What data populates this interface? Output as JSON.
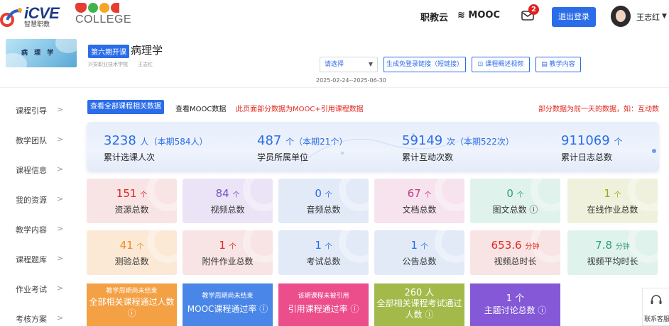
{
  "header": {
    "icve_logo": "iCVE",
    "icve_sub": "智慧职教",
    "mooc_logo": "MOOC",
    "college_logo": "COLLEGE",
    "nav_zhijiaoyun": "职教云",
    "nav_mooc": "MOOC",
    "message_count": "2",
    "logout_label": "退出登录",
    "user_name": "王志红",
    "colors": {
      "mooc_m": "#e63d32",
      "mooc_o1": "#3fb549",
      "mooc_o2": "#f5a623",
      "mooc_c": "#e63d32",
      "primary": "#2b6de8"
    }
  },
  "course": {
    "cover_title": "病 理 学",
    "term_tag": "第六期开课",
    "title": "病理学",
    "school": "兴安职业技术学院",
    "teacher": "王志红",
    "select_value": "请选择",
    "btn_share_link": "生成免登录链接（短链接）",
    "btn_overview_video": "课程概述视频",
    "btn_teaching_content": "教学内容",
    "date_range": "2025-02-24--2025-06-30"
  },
  "sidebar": {
    "items": [
      {
        "label": "课程引导"
      },
      {
        "label": "教学团队"
      },
      {
        "label": "课程信息"
      },
      {
        "label": "我的资源"
      },
      {
        "label": "教学内容"
      },
      {
        "label": "课程题库"
      },
      {
        "label": "作业考试"
      },
      {
        "label": "考核方案"
      }
    ]
  },
  "filters": {
    "tab_all": "查看全部课程相关数据",
    "tab_mooc": "查看MOOC数据",
    "note_left": "此页面部分数据为MOOC+引用课程数据",
    "note_right": "部分数据为前一天的数据，如：互动数"
  },
  "summary": [
    {
      "value": "3238",
      "unit": "人",
      "extra": "（本期584人）",
      "label": "累计选课人次"
    },
    {
      "value": "487",
      "unit": "个",
      "extra": "（本期21个）",
      "label": "学员所属单位"
    },
    {
      "value": "59149",
      "unit": "次",
      "extra": "（本期522次）",
      "label": "累计互动次数"
    },
    {
      "value": "911069",
      "unit": "个",
      "extra": "",
      "label": "累计日志总数"
    }
  ],
  "cards_row1": [
    {
      "value": "151",
      "unit": "个",
      "label": "资源总数",
      "color": "#e0271c"
    },
    {
      "value": "84",
      "unit": "个",
      "label": "视频总数",
      "color": "#7b52c9"
    },
    {
      "value": "0",
      "unit": "个",
      "label": "音频总数",
      "color": "#2b6de8"
    },
    {
      "value": "67",
      "unit": "个",
      "label": "文档总数",
      "color": "#c0398a"
    },
    {
      "value": "0",
      "unit": "个",
      "label": "图文总数 ⓘ",
      "color": "#2f9e7c"
    },
    {
      "value": "1",
      "unit": "个",
      "label": "在线作业总数",
      "color": "#9aaa1c"
    }
  ],
  "cards_row2": [
    {
      "value": "41",
      "unit": "个",
      "label": "测验总数",
      "color": "#f08a1e"
    },
    {
      "value": "1",
      "unit": "个",
      "label": "附件作业总数",
      "color": "#e0271c"
    },
    {
      "value": "1",
      "unit": "个",
      "label": "考试总数",
      "color": "#2b6de8"
    },
    {
      "value": "1",
      "unit": "个",
      "label": "公告总数",
      "color": "#2b6de8"
    },
    {
      "value": "653.6",
      "unit": "分钟",
      "label": "视频总时长",
      "color": "#e0271c"
    },
    {
      "value": "7.8",
      "unit": "分钟",
      "label": "视频平均时长",
      "color": "#2f9e7c"
    }
  ],
  "cards_row3": [
    {
      "small": "教学周期尚未结束",
      "big": "全部相关课程通过人数 ⓘ",
      "num": ""
    },
    {
      "small": "教学周期尚未结束",
      "big": "MOOC课程通过率 ⓘ",
      "num": ""
    },
    {
      "small": "该期课程未被引用",
      "big": "引用课程通过率 ⓘ",
      "num": ""
    },
    {
      "small": "",
      "big": "全部相关课程考试通过人数 ⓘ",
      "num": "260 人"
    },
    {
      "small": "",
      "big": "主题讨论总数 ⓘ",
      "num": "1 个"
    }
  ],
  "support_label": "联系客服"
}
